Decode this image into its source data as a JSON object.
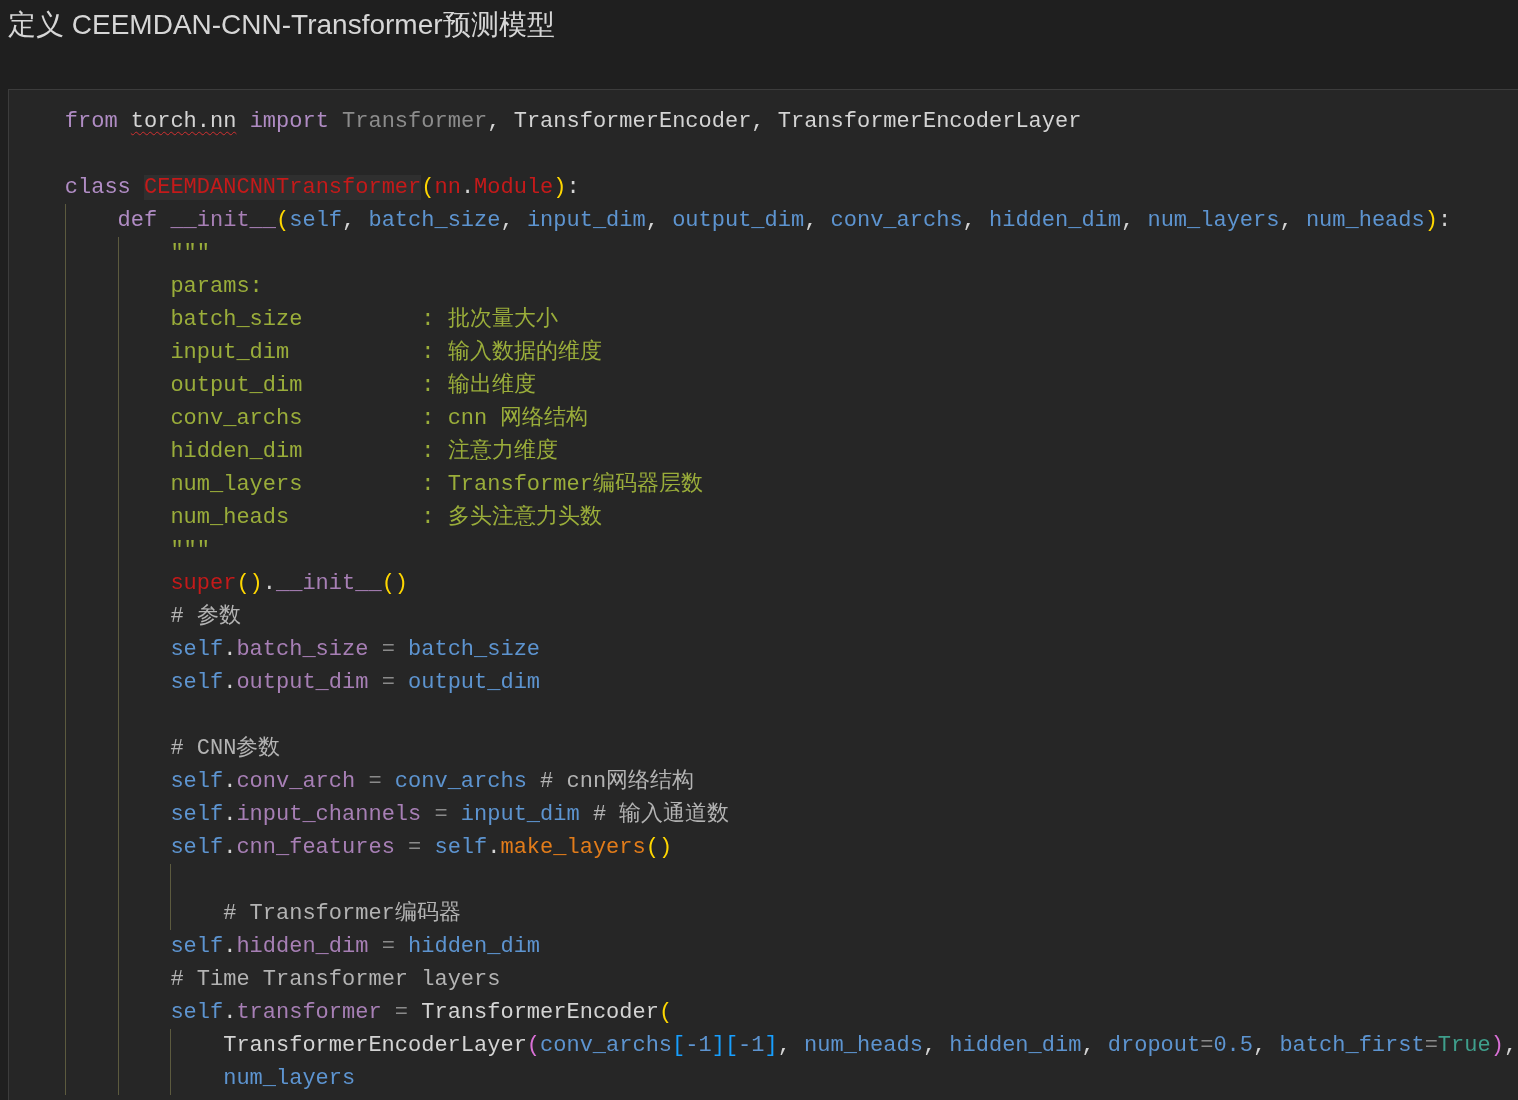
{
  "heading": "定义 CEEMDAN-CNN-Transformer预测模型",
  "code": {
    "lines": [
      {
        "kind": "code",
        "tokens": [
          {
            "kind": "keyword",
            "text": "from "
          },
          {
            "kind": "module-unresolved",
            "text": "torch.nn"
          },
          {
            "kind": "keyword",
            "text": " import "
          },
          {
            "kind": "unused",
            "text": "Transformer"
          },
          {
            "kind": "plain",
            "text": ", TransformerEncoder, TransformerEncoderLayer"
          }
        ]
      },
      {
        "kind": "blank"
      },
      {
        "kind": "code",
        "tokens": [
          {
            "kind": "keyword",
            "text": "class "
          },
          {
            "kind": "class-name",
            "text": "CEEMDANCNNTransformer"
          },
          {
            "kind": "bracket1",
            "text": "("
          },
          {
            "kind": "builtin",
            "text": "nn"
          },
          {
            "kind": "plain",
            "text": "."
          },
          {
            "kind": "builtin",
            "text": "Module"
          },
          {
            "kind": "bracket1",
            "text": ")"
          },
          {
            "kind": "plain",
            "text": ":"
          }
        ],
        "children": [
          {
            "kind": "code",
            "tokens": [
              {
                "kind": "keyword",
                "text": "def "
              },
              {
                "kind": "attribute",
                "text": "__init__"
              },
              {
                "kind": "bracket1",
                "text": "("
              },
              {
                "kind": "param",
                "text": "self"
              },
              {
                "kind": "plain",
                "text": ", "
              },
              {
                "kind": "param",
                "text": "batch_size"
              },
              {
                "kind": "plain",
                "text": ", "
              },
              {
                "kind": "param",
                "text": "input_dim"
              },
              {
                "kind": "plain",
                "text": ", "
              },
              {
                "kind": "param",
                "text": "output_dim"
              },
              {
                "kind": "plain",
                "text": ", "
              },
              {
                "kind": "param",
                "text": "conv_archs"
              },
              {
                "kind": "plain",
                "text": ", "
              },
              {
                "kind": "param",
                "text": "hidden_dim"
              },
              {
                "kind": "plain",
                "text": ", "
              },
              {
                "kind": "param",
                "text": "num_layers"
              },
              {
                "kind": "plain",
                "text": ", "
              },
              {
                "kind": "param",
                "text": "num_heads"
              },
              {
                "kind": "bracket1",
                "text": ")"
              },
              {
                "kind": "plain",
                "text": ":"
              }
            ],
            "children": [
              {
                "kind": "code",
                "tokens": [
                  {
                    "kind": "docstring",
                    "text": "\"\"\""
                  }
                ]
              },
              {
                "kind": "code",
                "tokens": [
                  {
                    "kind": "docstring",
                    "text": "params:"
                  }
                ]
              },
              {
                "kind": "code",
                "tokens": [
                  {
                    "kind": "docstring",
                    "text": "batch_size         : 批次量大小"
                  }
                ]
              },
              {
                "kind": "code",
                "tokens": [
                  {
                    "kind": "docstring",
                    "text": "input_dim          : 输入数据的维度"
                  }
                ]
              },
              {
                "kind": "code",
                "tokens": [
                  {
                    "kind": "docstring",
                    "text": "output_dim         : 输出维度"
                  }
                ]
              },
              {
                "kind": "code",
                "tokens": [
                  {
                    "kind": "docstring",
                    "text": "conv_archs         : cnn 网络结构"
                  }
                ]
              },
              {
                "kind": "code",
                "tokens": [
                  {
                    "kind": "docstring",
                    "text": "hidden_dim         : 注意力维度"
                  }
                ]
              },
              {
                "kind": "code",
                "tokens": [
                  {
                    "kind": "docstring",
                    "text": "num_layers         : Transformer编码器层数"
                  }
                ]
              },
              {
                "kind": "code",
                "tokens": [
                  {
                    "kind": "docstring",
                    "text": "num_heads          : 多头注意力头数"
                  }
                ]
              },
              {
                "kind": "code",
                "tokens": [
                  {
                    "kind": "docstring",
                    "text": "\"\"\""
                  }
                ]
              },
              {
                "kind": "code",
                "tokens": [
                  {
                    "kind": "builtin",
                    "text": "super"
                  },
                  {
                    "kind": "bracket1",
                    "text": "()"
                  },
                  {
                    "kind": "plain",
                    "text": "."
                  },
                  {
                    "kind": "attribute",
                    "text": "__init__"
                  },
                  {
                    "kind": "bracket1",
                    "text": "()"
                  }
                ]
              },
              {
                "kind": "code",
                "tokens": [
                  {
                    "kind": "comment",
                    "text": "# 参数"
                  }
                ]
              },
              {
                "kind": "code",
                "tokens": [
                  {
                    "kind": "self",
                    "text": "self"
                  },
                  {
                    "kind": "plain",
                    "text": "."
                  },
                  {
                    "kind": "attribute",
                    "text": "batch_size"
                  },
                  {
                    "kind": "operator",
                    "text": " = "
                  },
                  {
                    "kind": "param",
                    "text": "batch_size"
                  }
                ]
              },
              {
                "kind": "code",
                "tokens": [
                  {
                    "kind": "self",
                    "text": "self"
                  },
                  {
                    "kind": "plain",
                    "text": "."
                  },
                  {
                    "kind": "attribute",
                    "text": "output_dim"
                  },
                  {
                    "kind": "operator",
                    "text": " = "
                  },
                  {
                    "kind": "param",
                    "text": "output_dim"
                  }
                ]
              },
              {
                "kind": "blank"
              },
              {
                "kind": "code",
                "tokens": [
                  {
                    "kind": "comment",
                    "text": "# CNN参数"
                  }
                ]
              },
              {
                "kind": "code",
                "tokens": [
                  {
                    "kind": "self",
                    "text": "self"
                  },
                  {
                    "kind": "plain",
                    "text": "."
                  },
                  {
                    "kind": "attribute",
                    "text": "conv_arch"
                  },
                  {
                    "kind": "operator",
                    "text": " = "
                  },
                  {
                    "kind": "param",
                    "text": "conv_archs"
                  },
                  {
                    "kind": "comment",
                    "text": " # cnn网络结构"
                  }
                ]
              },
              {
                "kind": "code",
                "tokens": [
                  {
                    "kind": "self",
                    "text": "self"
                  },
                  {
                    "kind": "plain",
                    "text": "."
                  },
                  {
                    "kind": "attribute",
                    "text": "input_channels"
                  },
                  {
                    "kind": "operator",
                    "text": " = "
                  },
                  {
                    "kind": "param",
                    "text": "input_dim"
                  },
                  {
                    "kind": "comment",
                    "text": " # 输入通道数"
                  }
                ]
              },
              {
                "kind": "code",
                "tokens": [
                  {
                    "kind": "self",
                    "text": "self"
                  },
                  {
                    "kind": "plain",
                    "text": "."
                  },
                  {
                    "kind": "attribute",
                    "text": "cnn_features"
                  },
                  {
                    "kind": "operator",
                    "text": " = "
                  },
                  {
                    "kind": "self",
                    "text": "self"
                  },
                  {
                    "kind": "plain",
                    "text": "."
                  },
                  {
                    "kind": "method",
                    "text": "make_layers"
                  },
                  {
                    "kind": "bracket1",
                    "text": "()"
                  }
                ],
                "children": [
                  {
                    "kind": "blank"
                  },
                  {
                    "kind": "code",
                    "tokens": [
                      {
                        "kind": "comment",
                        "text": "# Transformer编码器"
                      }
                    ]
                  }
                ]
              },
              {
                "kind": "code",
                "tokens": [
                  {
                    "kind": "self",
                    "text": "self"
                  },
                  {
                    "kind": "plain",
                    "text": "."
                  },
                  {
                    "kind": "attribute",
                    "text": "hidden_dim"
                  },
                  {
                    "kind": "operator",
                    "text": " = "
                  },
                  {
                    "kind": "param",
                    "text": "hidden_dim"
                  }
                ]
              },
              {
                "kind": "code",
                "tokens": [
                  {
                    "kind": "comment",
                    "text": "# Time Transformer layers"
                  }
                ]
              },
              {
                "kind": "code",
                "tokens": [
                  {
                    "kind": "self",
                    "text": "self"
                  },
                  {
                    "kind": "plain",
                    "text": "."
                  },
                  {
                    "kind": "attribute",
                    "text": "transformer"
                  },
                  {
                    "kind": "operator",
                    "text": " = "
                  },
                  {
                    "kind": "plain",
                    "text": "TransformerEncoder"
                  },
                  {
                    "kind": "bracket1",
                    "text": "("
                  }
                ],
                "children": [
                  {
                    "kind": "code",
                    "tokens": [
                      {
                        "kind": "plain",
                        "text": "TransformerEncoderLayer"
                      },
                      {
                        "kind": "bracket2",
                        "text": "("
                      },
                      {
                        "kind": "param",
                        "text": "conv_archs"
                      },
                      {
                        "kind": "bracket3",
                        "text": "["
                      },
                      {
                        "kind": "param",
                        "text": "-1"
                      },
                      {
                        "kind": "bracket3",
                        "text": "]["
                      },
                      {
                        "kind": "param",
                        "text": "-1"
                      },
                      {
                        "kind": "bracket3",
                        "text": "]"
                      },
                      {
                        "kind": "plain",
                        "text": ", "
                      },
                      {
                        "kind": "param",
                        "text": "num_heads"
                      },
                      {
                        "kind": "plain",
                        "text": ", "
                      },
                      {
                        "kind": "param",
                        "text": "hidden_dim"
                      },
                      {
                        "kind": "plain",
                        "text": ", "
                      },
                      {
                        "kind": "param",
                        "text": "dropout"
                      },
                      {
                        "kind": "operator",
                        "text": "="
                      },
                      {
                        "kind": "param",
                        "text": "0.5"
                      },
                      {
                        "kind": "plain",
                        "text": ", "
                      },
                      {
                        "kind": "param",
                        "text": "batch_first"
                      },
                      {
                        "kind": "operator",
                        "text": "="
                      },
                      {
                        "kind": "constant",
                        "text": "True"
                      },
                      {
                        "kind": "bracket2",
                        "text": ")"
                      },
                      {
                        "kind": "plain",
                        "text": ","
                      }
                    ]
                  },
                  {
                    "kind": "code",
                    "tokens": [
                      {
                        "kind": "param",
                        "text": "num_layers"
                      }
                    ]
                  }
                ]
              }
            ]
          }
        ]
      }
    ]
  }
}
